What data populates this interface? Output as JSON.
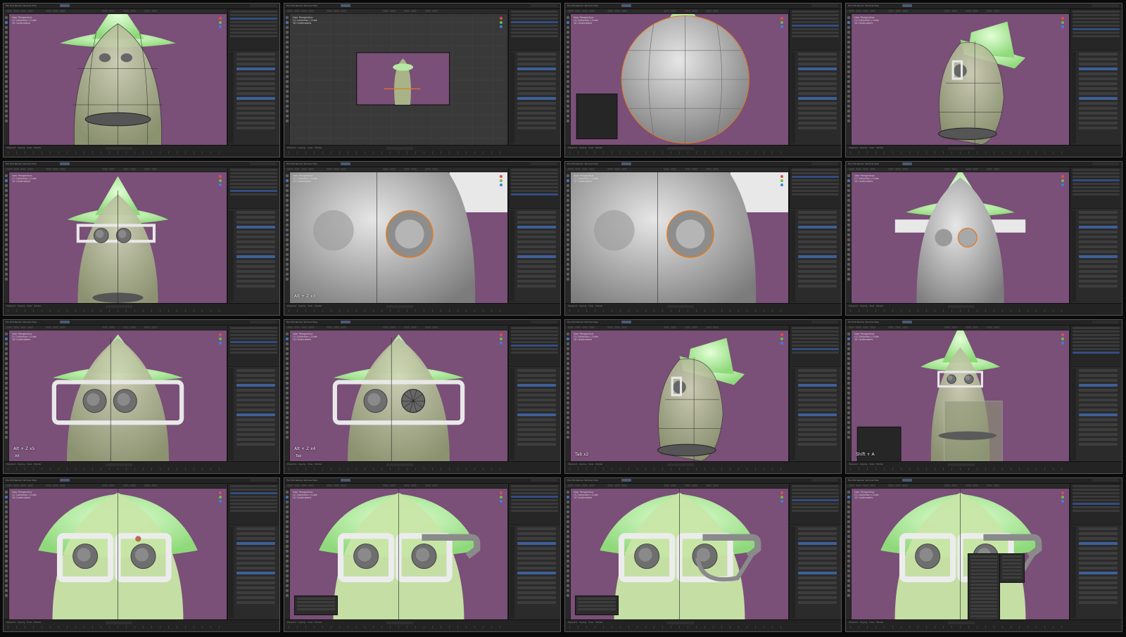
{
  "window": {
    "menus": [
      "File",
      "Edit",
      "Render",
      "Window",
      "Help"
    ],
    "viewport_info": [
      "User Perspective",
      "(1) Collection | Cube",
      "10 Centimeters"
    ]
  },
  "outliner": {
    "items": [
      "Scene Collection",
      "Collection",
      "Camera",
      "Hat",
      "Glasses",
      "Eyes",
      "Mouth",
      "Body"
    ]
  },
  "timeline": {
    "label": "Playback · Keying · View · Marker"
  },
  "frames": [
    {
      "id": "f1",
      "scene": "body-wire"
    },
    {
      "id": "f2",
      "scene": "camera-view"
    },
    {
      "id": "f3",
      "scene": "sphere-closeup"
    },
    {
      "id": "f4",
      "scene": "side-view"
    },
    {
      "id": "f5",
      "scene": "front-eyes"
    },
    {
      "id": "f6",
      "scene": "eye-closeup",
      "keys": "Alt + Z x3"
    },
    {
      "id": "f7",
      "scene": "eye-closeup"
    },
    {
      "id": "f8",
      "scene": "eye-sculpt"
    },
    {
      "id": "f9",
      "scene": "eyes-glasses",
      "keys": "Alt + Z x5",
      "sub": "Alt"
    },
    {
      "id": "f10",
      "scene": "eyes-edit",
      "keys": "Alt + Z x4",
      "sub": "Tab"
    },
    {
      "id": "f11",
      "scene": "side-view",
      "keys": "Tab x2"
    },
    {
      "id": "f12",
      "scene": "mouth-box",
      "keys": "Shift + A"
    },
    {
      "id": "f13",
      "scene": "glasses-close"
    },
    {
      "id": "f14",
      "scene": "glasses-arm"
    },
    {
      "id": "f15",
      "scene": "glasses-arm2"
    },
    {
      "id": "f16",
      "scene": "glasses-menu"
    }
  ],
  "colors": {
    "viewport_bg": "#7a4f78",
    "body": "#aab489",
    "hat": "#b9eea3",
    "select": "#e07a22",
    "ui_blue": "#4772b3"
  }
}
